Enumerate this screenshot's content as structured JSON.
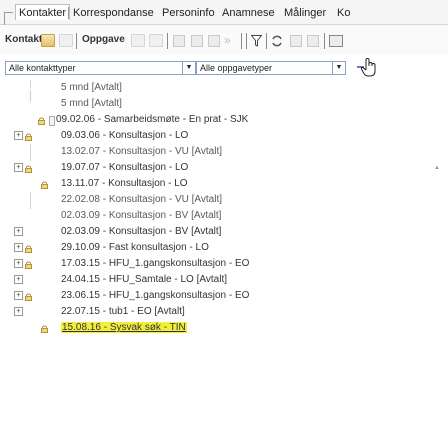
{
  "tabs": [
    {
      "label": "Kontakter",
      "active": true
    },
    {
      "label": "Korrespondanse",
      "active": false
    },
    {
      "label": "Personinfo",
      "active": false
    },
    {
      "label": "Anamnese",
      "active": false
    },
    {
      "label": "Målinger",
      "active": false
    },
    {
      "label": "Ko",
      "active": false
    }
  ],
  "toolbar": {
    "kontakt_label": "Kontakt",
    "oppgave_label": "Oppgave"
  },
  "filters": {
    "contact_type": "Alle kontakttyper",
    "task_type": "Alle oppgavetyper"
  },
  "tree": {
    "rows": [
      {
        "text": "5 mnd [Avtalt]"
      },
      {
        "text": "5 mnd [Avtalt]"
      },
      {
        "text": "09.02.06 - Samarbeidsmøte - En prat - SJK"
      },
      {
        "text": "09.03.06 - Konsultasjon - LO"
      },
      {
        "text": "13.02.07 - Konsultasjon - VU [Avtalt]"
      },
      {
        "text": "19.07.07 - Konsultasjon - LO"
      },
      {
        "text": "13.11.07 - Konsultasjon - LO"
      },
      {
        "text": "22.02.08 - Konsultasjon - VU [Avtalt]"
      },
      {
        "text": "02.03.09 - Konsultasjon - BV [Avtalt]"
      },
      {
        "text": "02.03.09 - Konsultasjon - BV [Avtalt]"
      },
      {
        "text": "29.10.09 - Fast konsultasjon - LO"
      },
      {
        "text": "17.03.15 - HFU_1.gangskonsultasjon - EO"
      },
      {
        "text": "24.04.15 - HFU_Samtale - LO [Avtalt]"
      },
      {
        "text": "23.06.15 - HFU_1.gangskonsultasjon - EO"
      },
      {
        "text": "22.07.15 - tub1 - EO [Avtalt]"
      },
      {
        "text": "15.08.16 - Sysvak søk - TIN"
      }
    ]
  },
  "colors": {
    "highlight": "#f2ef3a",
    "select_border": "#8aa0c8",
    "folder": "#e3c26a"
  }
}
